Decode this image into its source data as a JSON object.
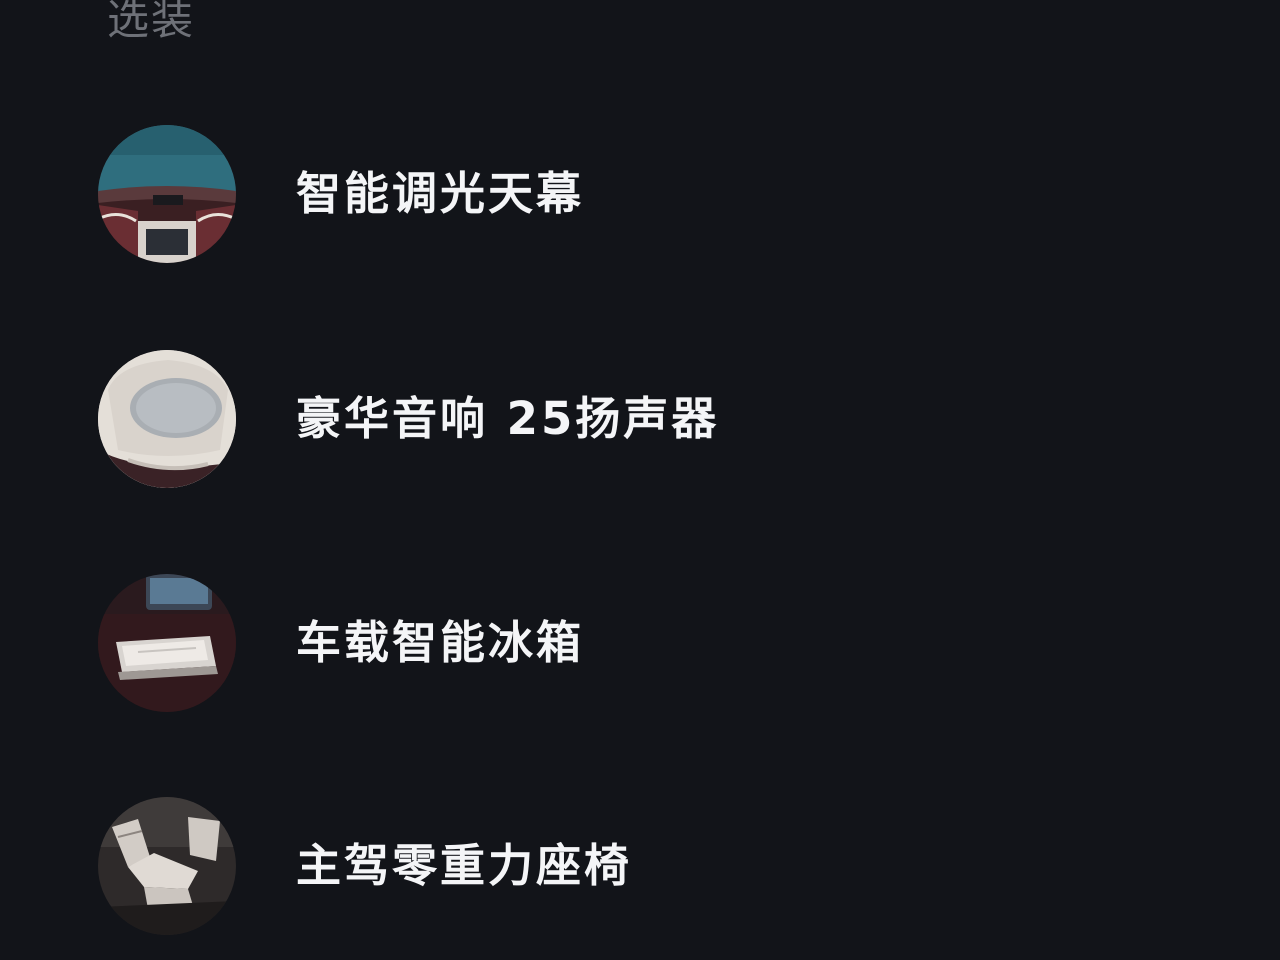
{
  "section": {
    "heading": "选装"
  },
  "options": [
    {
      "label": "智能调光天幕",
      "image_icon": "panoramic-sunroof-photo"
    },
    {
      "label": "豪华音响 25扬声器",
      "image_icon": "speaker-grille-photo"
    },
    {
      "label": "车载智能冰箱",
      "image_icon": "car-fridge-photo"
    },
    {
      "label": "主驾零重力座椅",
      "image_icon": "zero-gravity-seat-photo"
    }
  ],
  "colors": {
    "background": "#121419",
    "heading": "#6e7178",
    "label": "#f4f5f7"
  }
}
